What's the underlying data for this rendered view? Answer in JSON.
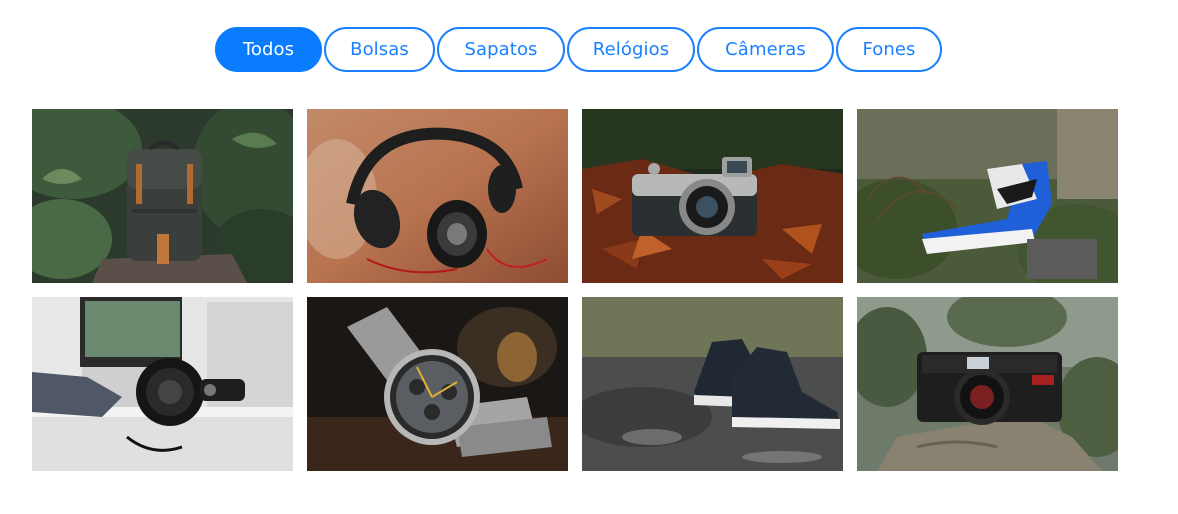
{
  "filters": {
    "items": [
      {
        "label": "Todos",
        "active": true
      },
      {
        "label": "Bolsas",
        "active": false
      },
      {
        "label": "Sapatos",
        "active": false
      },
      {
        "label": "Relógios",
        "active": false
      },
      {
        "label": "Câmeras",
        "active": false
      },
      {
        "label": "Fones",
        "active": false
      }
    ]
  },
  "gallery": {
    "items": [
      {
        "subject": "backpack"
      },
      {
        "subject": "headphones"
      },
      {
        "subject": "camera"
      },
      {
        "subject": "sneaker"
      },
      {
        "subject": "headphones"
      },
      {
        "subject": "watch"
      },
      {
        "subject": "sneaker"
      },
      {
        "subject": "camera"
      }
    ]
  },
  "colors": {
    "accent": "#0a7cff",
    "accent_border": "#1a80ff",
    "background": "#ffffff"
  }
}
